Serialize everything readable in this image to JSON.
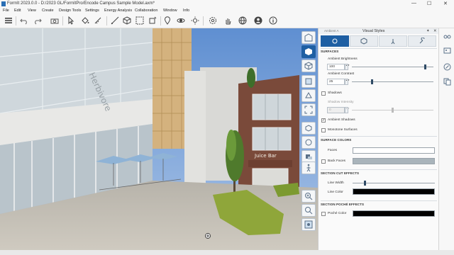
{
  "window": {
    "title": "FormIt 2023.0.0 - D:/2023 GL/FormItPro/Encode Campus Sample Model.axm*",
    "minimize": "—",
    "maximize": "☐",
    "close": "✕"
  },
  "menu": [
    "File",
    "Edit",
    "View",
    "Create",
    "Design Tools",
    "Settings",
    "Energy Analysis",
    "Collaboration",
    "Window",
    "Info"
  ],
  "toolbar_icons": [
    "menu-icon",
    "undo-icon",
    "redo-icon",
    "camera-icon",
    "select-arrow-icon",
    "paint-bucket-icon",
    "tape-measure-icon",
    "line-tool-icon",
    "cube-icon",
    "group-icon",
    "move-icon",
    "location-pin-icon",
    "orbit-icon",
    "settings-icon",
    "hand-icon",
    "user-icon",
    "globe-icon",
    "info-icon"
  ],
  "viewport": {
    "signs": {
      "building_sign": "Herbivore",
      "shop_sign": "Juice Bar"
    }
  },
  "vertical_toolbar_icons": [
    "home-icon",
    "cube-solid-icon",
    "cube-wire-icon",
    "cube-edges-icon",
    "section-box-icon",
    "shadow-cube-icon",
    "scan-icon",
    "orbit-icon",
    "cube-sun-icon",
    "camera-rotate-icon",
    "zoom-in-icon",
    "zoom-fit-icon",
    "minimap-icon"
  ],
  "panel": {
    "title": "Visual Styles",
    "pin": "✦",
    "close": "✕",
    "top_cut": "Ambient A",
    "tabs": [
      "sun-icon",
      "cube-icon",
      "walk-icon",
      "wrench-icon"
    ],
    "surfaces_header": "SURFACES",
    "ambient_brightness_label": "Ambient Brightness",
    "ambient_brightness_value": "100",
    "ambient_brightness_level": 0.9,
    "ambient_contrast_label": "Ambient Contrast",
    "ambient_contrast_value": "25",
    "ambient_contrast_level": 0.25,
    "shadows_label": "Shadows",
    "shadows_checked": false,
    "shadow_intensity_label": "Shadow Intensity",
    "shadow_intensity_value": "0",
    "shadow_intensity_level": 0.5,
    "ambient_shadows_label": "Ambient Shadows",
    "ambient_shadows_checked": true,
    "monotone_label": "Monotone Surfaces",
    "monotone_checked": false,
    "surface_colors_header": "SURFACE COLORS",
    "faces_label": "Faces",
    "faces_color": "#ffffff",
    "back_faces_label": "Back Faces",
    "back_faces_color": "#a9b4bb",
    "back_faces_checked": false,
    "section_cut_header": "SECTION CUT EFFECTS",
    "line_width_label": "Line Width",
    "line_width_level": 0.15,
    "line_color_label": "Line Color",
    "line_color": "#000000",
    "section_poche_header": "SECTION POCHÉ EFFECTS",
    "poche_color_label": "Poché Color",
    "poche_color": "#000000",
    "poche_checked": false
  },
  "right_sidebar_icons": [
    "glasses-icon",
    "image-icon",
    "pencil-icon",
    "copy-icon"
  ],
  "colors": {
    "accent": "#1e5fa3",
    "sky": "#7fa4d6",
    "brick": "#7a4a3a"
  }
}
